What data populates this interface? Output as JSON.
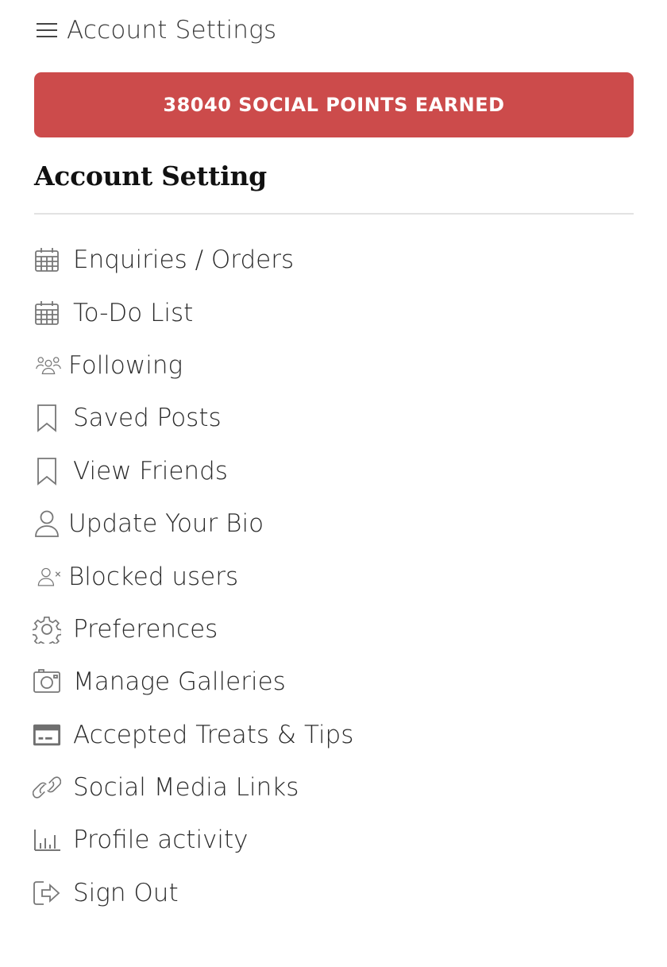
{
  "header": {
    "menu_icon": "hamburger-menu-icon",
    "title": "Account Settings"
  },
  "banner": {
    "text": "38040 SOCIAL POINTS EARNED",
    "color": "#cc4b4b"
  },
  "section": {
    "heading": "Account Setting"
  },
  "menu": {
    "items": [
      {
        "label": "Enquiries / Orders",
        "icon": "calendar-icon"
      },
      {
        "label": "To-Do List",
        "icon": "calendar-icon"
      },
      {
        "label": "Following",
        "icon": "users-group-icon"
      },
      {
        "label": "Saved Posts",
        "icon": "bookmark-icon"
      },
      {
        "label": "View Friends",
        "icon": "bookmark-icon"
      },
      {
        "label": "Update Your Bio",
        "icon": "user-icon"
      },
      {
        "label": "Blocked users",
        "icon": "user-blocked-icon"
      },
      {
        "label": "Preferences",
        "icon": "gear-icon"
      },
      {
        "label": "Manage Galleries",
        "icon": "camera-icon"
      },
      {
        "label": "Accepted Treats & Tips",
        "icon": "credit-card-icon"
      },
      {
        "label": "Social Media Links",
        "icon": "link-icon"
      },
      {
        "label": "Profile activity",
        "icon": "bar-chart-icon"
      },
      {
        "label": "Sign Out",
        "icon": "sign-out-icon"
      }
    ]
  },
  "colors": {
    "icon": "#777777",
    "text": "#2b2b2b"
  }
}
